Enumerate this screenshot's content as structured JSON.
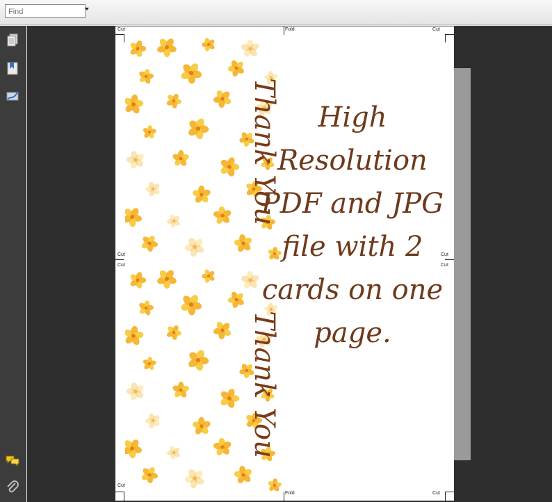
{
  "find": {
    "placeholder": "Find",
    "value": ""
  },
  "nav": {
    "pages_icon": "pages-icon",
    "bookmarks_icon": "bookmarks-icon",
    "signatures_icon": "signature-icon",
    "comments_icon": "comments-icon",
    "attachments_icon": "attachment-icon"
  },
  "page": {
    "marks": {
      "cut": "Cut",
      "fold": "Fold"
    },
    "card_text_1": "Thank",
    "card_text_2": "You",
    "promo_lines": [
      "High",
      "Resolution",
      "PDF and JPG",
      "file with 2",
      "cards on one",
      "page."
    ]
  },
  "colors": {
    "toolbar": "#e8e8e8",
    "workspace": "#2e2e2e",
    "rail": "#3c3c3c",
    "text_brown": "#6e3a1c",
    "flower_yellow": "#f6c33a"
  }
}
